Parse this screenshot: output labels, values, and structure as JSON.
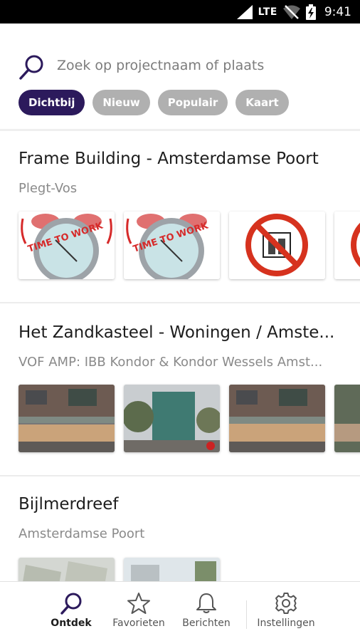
{
  "status_bar": {
    "network": "LTE",
    "time": "9:41"
  },
  "search": {
    "placeholder": "Zoek op projectnaam of plaats"
  },
  "chips": [
    {
      "label": "Dichtbij",
      "active": true
    },
    {
      "label": "Nieuw",
      "active": false
    },
    {
      "label": "Populair",
      "active": false
    },
    {
      "label": "Kaart",
      "active": false
    }
  ],
  "projects": [
    {
      "title": "Frame Building - Amsterdamse Poort",
      "subtitle": "Plegt-Vos",
      "thumb_text": "TIME TO WORK"
    },
    {
      "title": "Het Zandkasteel - Woningen / Amste...",
      "subtitle": "VOF AMP: IBB Kondor & Kondor Wessels Amst..."
    },
    {
      "title": "Bijlmerdreef",
      "subtitle": "Amsterdamse Poort"
    }
  ],
  "nav": {
    "items": [
      {
        "label": "Ontdek",
        "icon": "search-icon",
        "active": true
      },
      {
        "label": "Favorieten",
        "icon": "star-icon",
        "active": false
      },
      {
        "label": "Berichten",
        "icon": "bell-icon",
        "active": false
      },
      {
        "label": "Instellingen",
        "icon": "gear-icon",
        "active": false
      }
    ]
  },
  "colors": {
    "accent": "#2c1a5c",
    "chip_inactive": "#b0b0b0",
    "clock_red": "#d62a2a"
  }
}
